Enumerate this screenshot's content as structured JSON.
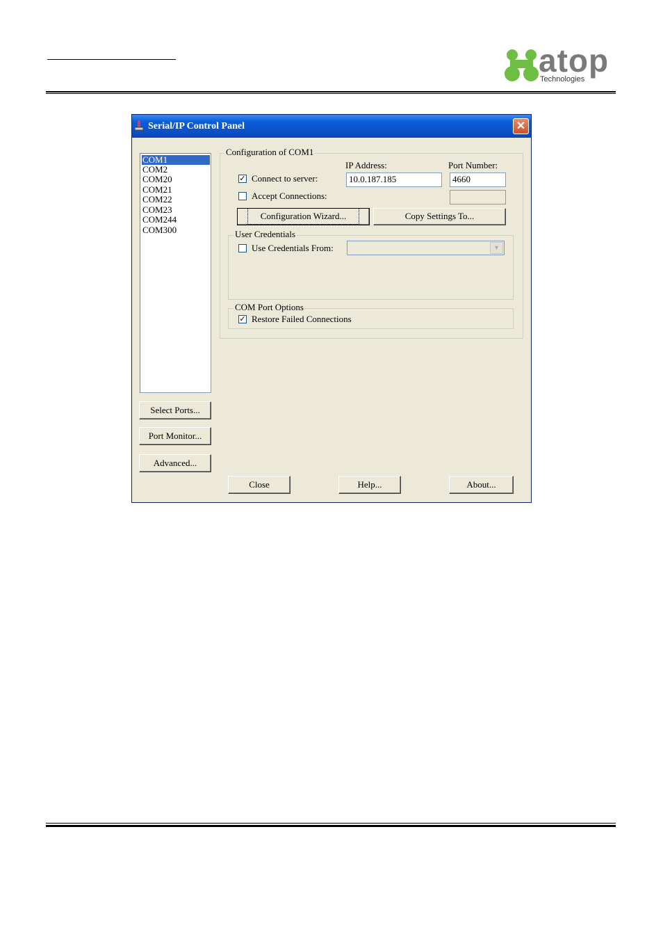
{
  "logo": {
    "word": "atop",
    "sub": "Technologies"
  },
  "window": {
    "title": "Serial/IP Control Panel",
    "close_glyph": "✕",
    "ports": [
      "COM1",
      "COM2",
      "COM20",
      "COM21",
      "COM22",
      "COM23",
      "COM244",
      "COM300"
    ],
    "selected_port": "COM1",
    "buttons": {
      "select_ports": "Select Ports...",
      "port_monitor": "Port Monitor...",
      "advanced": "Advanced...",
      "close": "Close",
      "help": "Help...",
      "about": "About...",
      "config_wizard": "Configuration Wizard...",
      "copy_settings": "Copy Settings To..."
    },
    "config": {
      "group_label": "Configuration of COM1",
      "ip_label": "IP Address:",
      "port_label": "Port Number:",
      "connect_label": "Connect to server:",
      "connect_checked": true,
      "ip_value": "10.0.187.185",
      "port_value": "4660",
      "accept_label": "Accept Connections:",
      "accept_checked": false,
      "accept_port_value": ""
    },
    "credentials": {
      "group_label": "User Credentials",
      "use_label": "Use Credentials From:",
      "use_checked": false,
      "selected": ""
    },
    "options": {
      "group_label": "COM Port Options",
      "restore_label": "Restore Failed Connections",
      "restore_checked": true
    }
  }
}
